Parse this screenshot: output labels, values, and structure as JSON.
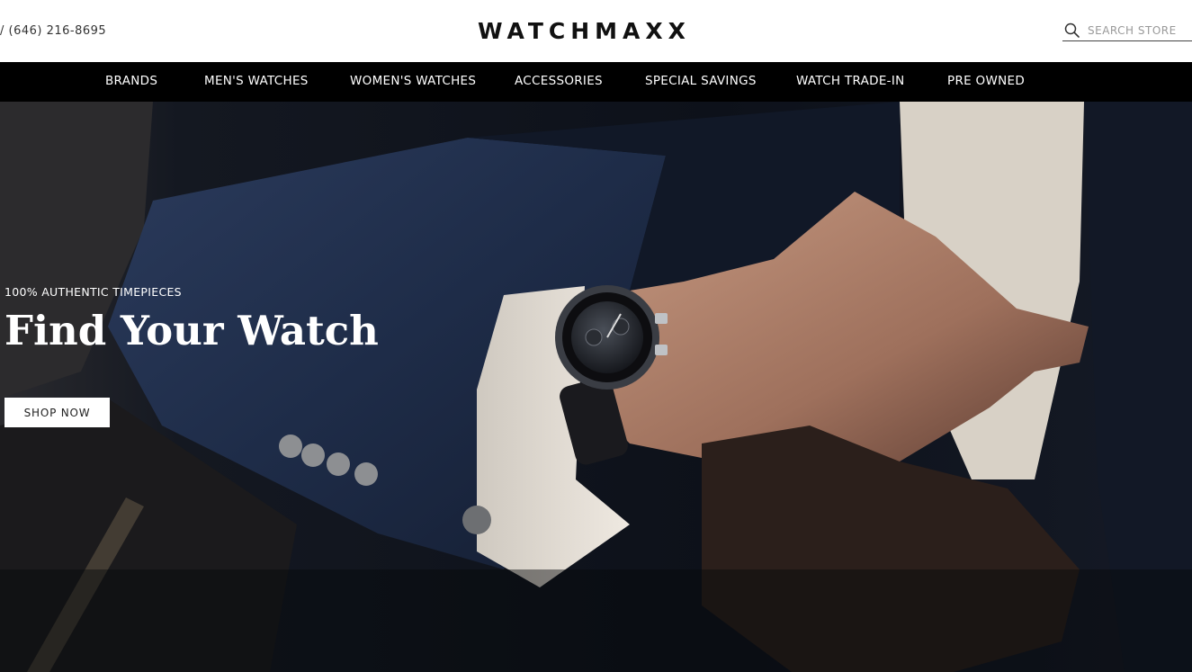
{
  "header": {
    "phone": "/ (646) 216-8695",
    "logo": "WATCHMAXX",
    "search": {
      "placeholder": "SEARCH STORE",
      "icon": "search-icon"
    }
  },
  "nav": {
    "items": [
      {
        "label": "BRANDS"
      },
      {
        "label": "MEN'S WATCHES"
      },
      {
        "label": "WOMEN'S WATCHES"
      },
      {
        "label": "ACCESSORIES"
      },
      {
        "label": "SPECIAL SAVINGS"
      },
      {
        "label": "WATCH TRADE-IN"
      },
      {
        "label": "PRE OWNED"
      }
    ]
  },
  "hero": {
    "eyebrow": "100% AUTHENTIC TIMEPIECES",
    "headline": "Find Your Watch",
    "cta": "SHOP NOW"
  },
  "colors": {
    "nav_bg": "#000000",
    "hero_bg": "#0e1016",
    "suit_navy": "#1c2a45",
    "text_light": "#ffffff"
  }
}
